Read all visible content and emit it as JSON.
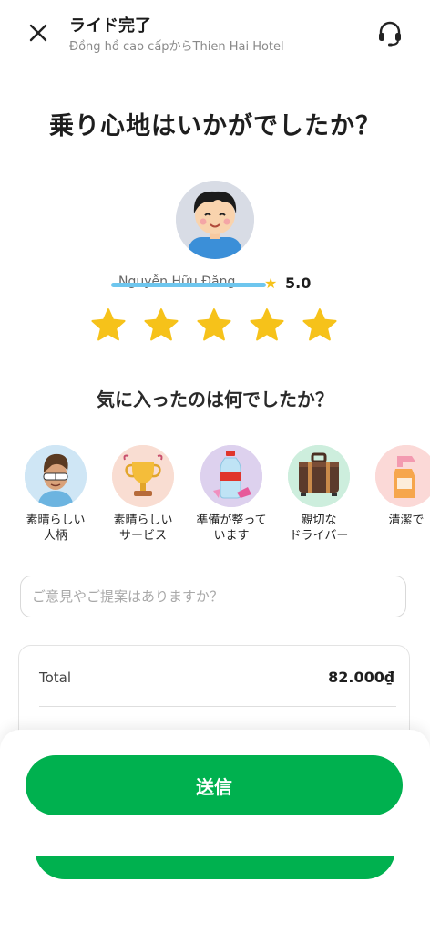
{
  "header": {
    "title": "ライド完了",
    "subtitle": "Đồng hồ cao cấpからThien Hai Hotel"
  },
  "question": "乗り心地はいかがでしたか？",
  "driver": {
    "name": "Nguyễn Hữu Đăng",
    "rating": "5.0"
  },
  "rating_stars": {
    "filled": 5,
    "total": 5,
    "color": "#f6c21a"
  },
  "like_question": "気に入ったのは何でしたか？",
  "compliments": [
    {
      "label": "素晴らしい\n人柄",
      "icon": "cool-person-icon"
    },
    {
      "label": "素晴らしい\nサービス",
      "icon": "trophy-icon"
    },
    {
      "label": "準備が整って\nいます",
      "icon": "water-bottle-candy-icon"
    },
    {
      "label": "親切な\nドライバー",
      "icon": "suitcase-icon"
    },
    {
      "label": "清潔で",
      "icon": "spray-bottle-icon"
    }
  ],
  "feedback": {
    "placeholder": "ご意見やご提案はありますか？"
  },
  "total": {
    "label": "Total",
    "value": "82.000₫"
  },
  "submit_label": "送信",
  "colors": {
    "accent": "#00b14f",
    "star": "#f6c21a"
  }
}
